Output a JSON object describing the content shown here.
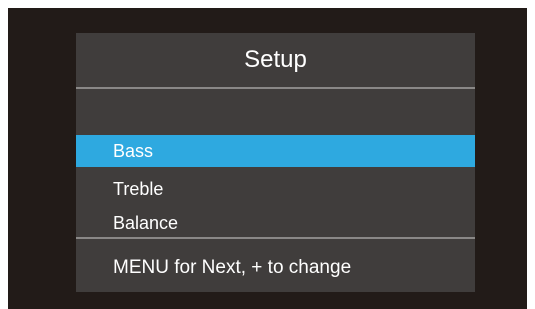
{
  "panel": {
    "title": "Setup"
  },
  "menu": {
    "items": [
      {
        "label": "Bass",
        "selected": true
      },
      {
        "label": "Treble",
        "selected": false
      },
      {
        "label": "Balance",
        "selected": false
      }
    ]
  },
  "footer": {
    "hint": "MENU for Next, + to change"
  },
  "colors": {
    "screen_background": "#221b18",
    "panel_background": "#403d3c",
    "selection_highlight": "#2ea9e0",
    "divider": "#8a8887",
    "text": "#ffffff"
  }
}
